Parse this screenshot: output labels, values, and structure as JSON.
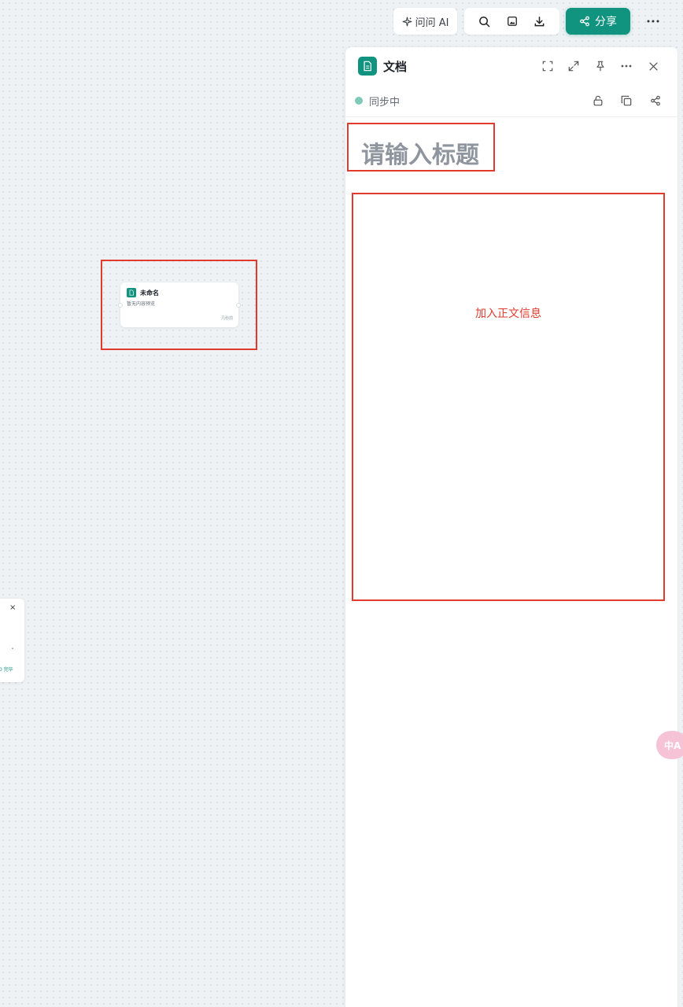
{
  "topbar": {
    "ask_ai_label": "问问 AI",
    "share_label": "分享"
  },
  "panel": {
    "title": "文档",
    "status": "同步中",
    "title_placeholder": "请输入标题",
    "body_annotation": "加入正文信息"
  },
  "canvas_node": {
    "title": "未命名",
    "preview": "暂无内容预览",
    "time": "几秒前"
  },
  "left_popup": {
    "close_glyph": "×",
    "caret_glyph": "ˆ",
    "label": "O 完毕"
  },
  "translate_button": {
    "label": "中A"
  },
  "colors": {
    "accent": "#10937f",
    "annotation_red": "#e23b2e",
    "canvas_bg": "#eef2f4",
    "status_dot": "#7ecbb6"
  }
}
